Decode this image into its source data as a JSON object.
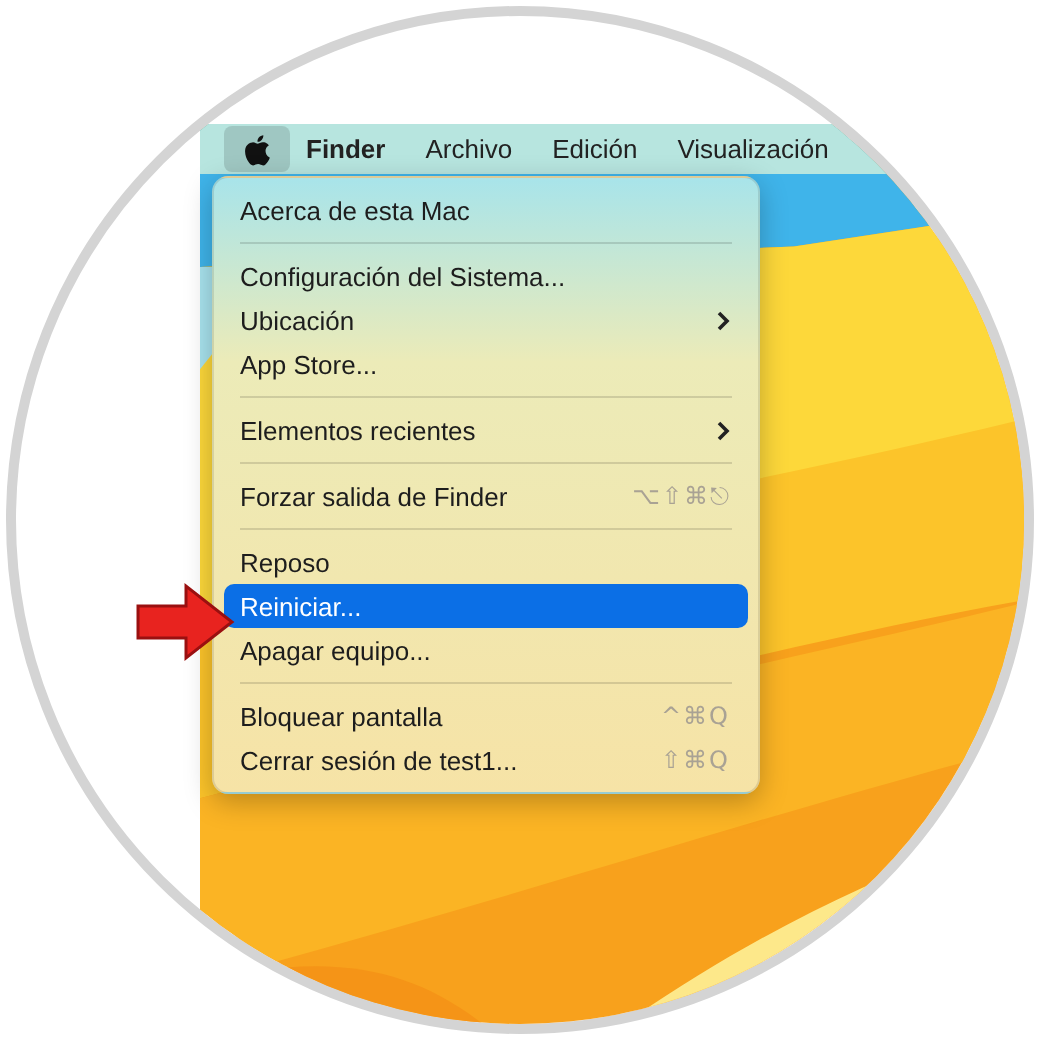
{
  "menu_bar": {
    "apple_menu": {
      "selected": true
    },
    "items": [
      {
        "label": "Finder",
        "kind": "app"
      },
      {
        "label": "Archivo",
        "kind": "menu"
      },
      {
        "label": "Edición",
        "kind": "menu"
      },
      {
        "label": "Visualización",
        "kind": "menu"
      }
    ]
  },
  "apple_menu": {
    "entries": [
      {
        "kind": "item",
        "label": "Acerca de esta Mac",
        "submenu": false,
        "selected": false
      },
      {
        "kind": "separator"
      },
      {
        "kind": "item",
        "label": "Configuración del Sistema...",
        "submenu": false,
        "selected": false
      },
      {
        "kind": "item",
        "label": "Ubicación",
        "submenu": true,
        "selected": false
      },
      {
        "kind": "item",
        "label": "App Store...",
        "submenu": false,
        "selected": false
      },
      {
        "kind": "separator"
      },
      {
        "kind": "item",
        "label": "Elementos recientes",
        "submenu": true,
        "selected": false
      },
      {
        "kind": "separator"
      },
      {
        "kind": "item",
        "label": "Forzar salida de Finder",
        "shortcut": "⌥⇧⌘⎋",
        "submenu": false,
        "selected": false
      },
      {
        "kind": "separator"
      },
      {
        "kind": "item",
        "label": "Reposo",
        "submenu": false,
        "selected": false
      },
      {
        "kind": "item",
        "label": "Reiniciar...",
        "submenu": false,
        "selected": true
      },
      {
        "kind": "item",
        "label": "Apagar equipo...",
        "submenu": false,
        "selected": false
      },
      {
        "kind": "separator"
      },
      {
        "kind": "item",
        "label": "Bloquear pantalla",
        "shortcut": "^⌘Q",
        "submenu": false,
        "selected": false
      },
      {
        "kind": "item",
        "label": "Cerrar sesión de test1...",
        "shortcut": "⇧⌘Q",
        "submenu": false,
        "selected": false
      }
    ]
  },
  "pointer_arrow": {
    "kind": "arrow"
  }
}
